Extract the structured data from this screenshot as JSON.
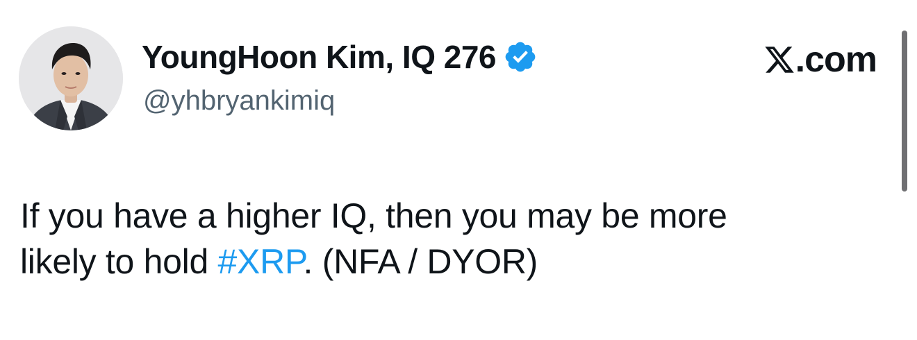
{
  "author": {
    "display_name": "YoungHoon Kim, IQ 276",
    "handle": "@yhbryankimiq",
    "verified": true,
    "avatar_icon": "profile-photo"
  },
  "brand": {
    "text": ".com",
    "logo_icon": "x-logo-icon"
  },
  "tweet": {
    "line1": "If you have a higher IQ, then you may be more",
    "line2_before": "likely to hold ",
    "hashtag": "#XRP",
    "line2_after": ". (NFA / DYOR)"
  },
  "colors": {
    "text": "#0f1419",
    "secondary": "#536471",
    "link": "#1d9bf0",
    "verified": "#1d9bf0"
  }
}
